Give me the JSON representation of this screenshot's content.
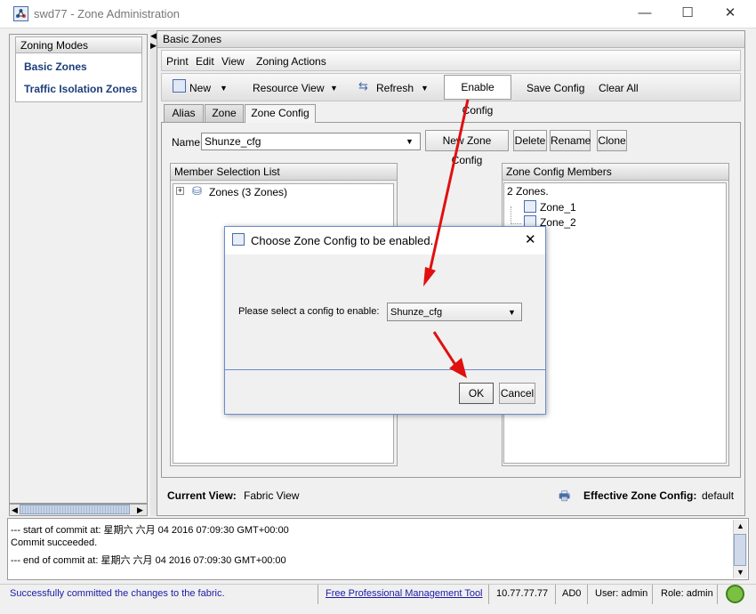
{
  "window": {
    "title": "swd77 - Zone Administration",
    "minimize": "—",
    "maximize": "☐",
    "close": "✕"
  },
  "zoning_modes": {
    "header": "Zoning Modes",
    "items": [
      "Basic Zones",
      "Traffic Isolation Zones"
    ]
  },
  "basic_zones": {
    "header": "Basic Zones",
    "menu": [
      "Print",
      "Edit",
      "View",
      "Zoning Actions"
    ],
    "toolbar": {
      "new": "New",
      "resource_view": "Resource View",
      "refresh": "Refresh",
      "enable_config": "Enable Config",
      "save_config": "Save Config",
      "clear_all": "Clear All"
    },
    "tabs": [
      "Alias",
      "Zone",
      "Zone Config"
    ],
    "name_label": "Name",
    "name_value": "Shunze_cfg",
    "buttons": {
      "new_zone_config": "New Zone Config",
      "delete": "Delete",
      "rename": "Rename",
      "clone": "Clone"
    },
    "member_selection": {
      "header": "Member Selection List",
      "expander": "+",
      "tree_item": "Zones (3 Zones)"
    },
    "zone_config_members": {
      "header": "Zone Config Members",
      "count": "2 Zones.",
      "items": [
        "Zone_1",
        "Zone_2"
      ]
    },
    "current_view_label": "Current View:",
    "current_view_value": "Fabric View",
    "effective_label": "Effective Zone Config:",
    "effective_value": "default"
  },
  "log": [
    "--- start of commit at: 星期六 六月 04 2016 07:09:30 GMT+00:00",
    "Commit succeeded.",
    "--- end of commit at: 星期六 六月 04 2016 07:09:30 GMT+00:00"
  ],
  "statusbar": {
    "message": "Successfully committed the changes to the fabric.",
    "link": "Free Professional Management Tool",
    "ip": "10.77.77.77",
    "ad": "AD0",
    "user": "User: admin",
    "role": "Role: admin"
  },
  "dialog": {
    "title": "Choose Zone Config to be enabled..",
    "prompt": "Please select a config to enable:",
    "selected": "Shunze_cfg",
    "ok": "OK",
    "cancel": "Cancel",
    "close": "✕"
  },
  "colors": {
    "annotation_arrow": "#e01010",
    "link_blue": "#1c3d7a",
    "status_blue": "#1a1aa8"
  }
}
